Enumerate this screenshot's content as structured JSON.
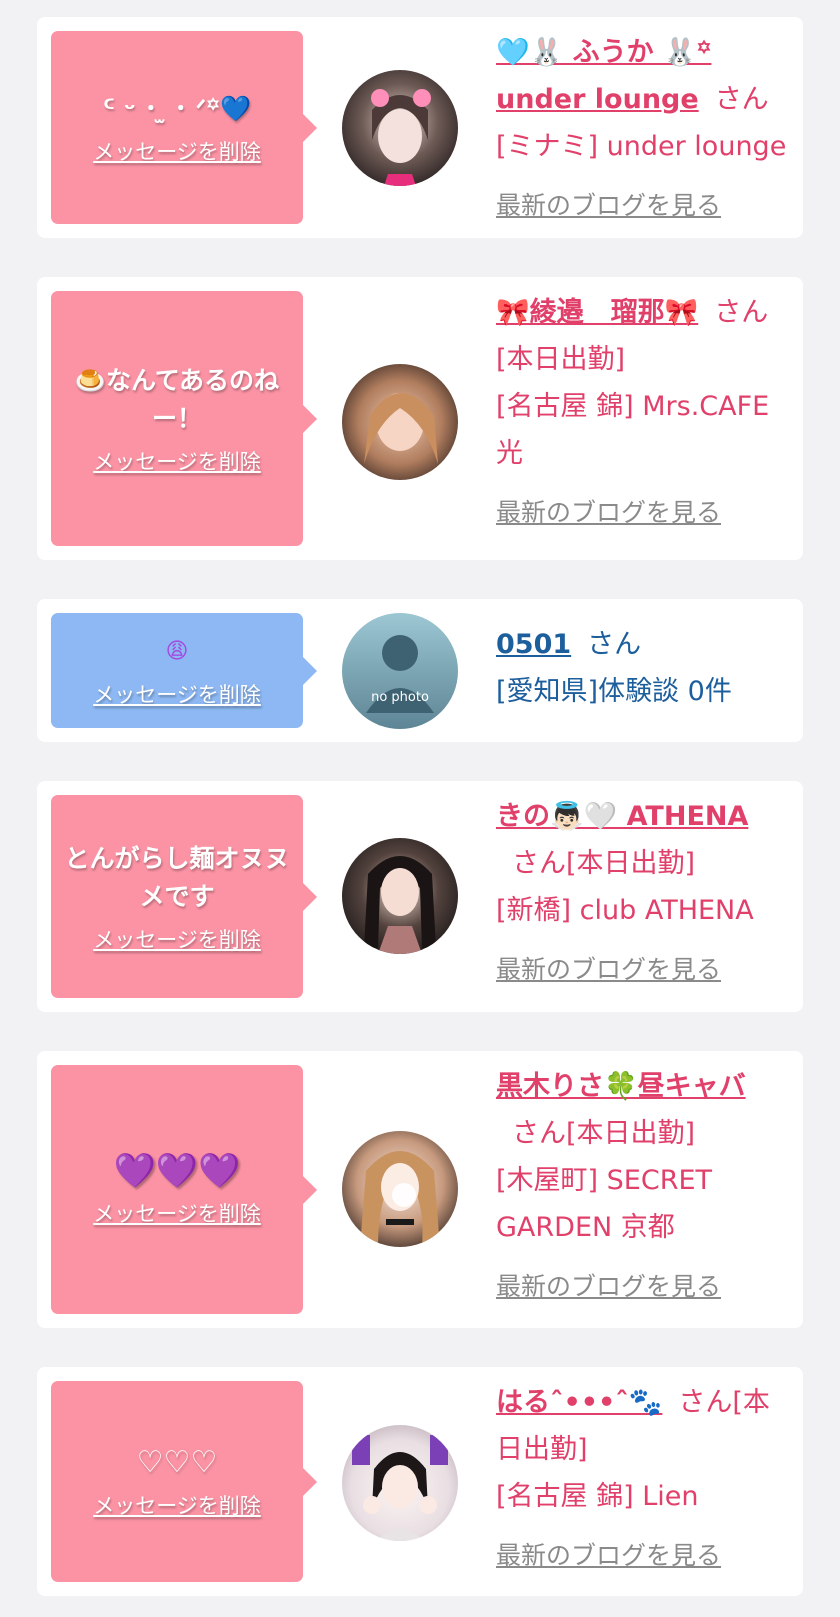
{
  "common": {
    "delete_label": "メッセージを削除",
    "san": "さん",
    "blog_label": "最新のブログを見る"
  },
  "items": [
    {
      "message": "ᑦ ᵕ ･ ̫ ･ ᐟ꙳💙",
      "name": "🩵🐰 ふうか 🐰꙳ under lounge",
      "status": "",
      "shop": "[ミナミ] under lounge",
      "has_blog": true
    },
    {
      "message": "🍮なんてあるのねー！",
      "name": "🎀綾邉　瑠那🎀",
      "status": "[本日出勤]",
      "shop": "[名古屋 錦] Mrs.CAFE 光",
      "has_blog": true
    },
    {
      "message": "😩",
      "name": "0501",
      "status": "",
      "shop": "[愛知県]体験談 0件",
      "has_blog": false,
      "avatar_caption": "no photo"
    },
    {
      "message": "とんがらし麺オヌヌメです",
      "name": "きの👼🏻🤍 ATHENA",
      "status": "[本日出勤]",
      "shop": "[新橋] club ATHENA",
      "has_blog": true
    },
    {
      "message": "💜💜💜",
      "name": "黒木りさ🍀昼キャバ",
      "status": "[本日出勤]",
      "shop": "[木屋町] SECRET GARDEN 京都",
      "has_blog": true
    },
    {
      "message": "♡♡♡",
      "name": "はるˆ•••ˆ🐾",
      "status": "[本日出勤]",
      "shop": "[名古屋 錦] Lien",
      "has_blog": true
    }
  ],
  "colors": {
    "pink_bubble": "#fb93a4",
    "blue_bubble": "#8db8f3",
    "name_pink": "#e0406a",
    "name_blue": "#1d5e9c",
    "blog_gray": "#8a8a8a"
  }
}
